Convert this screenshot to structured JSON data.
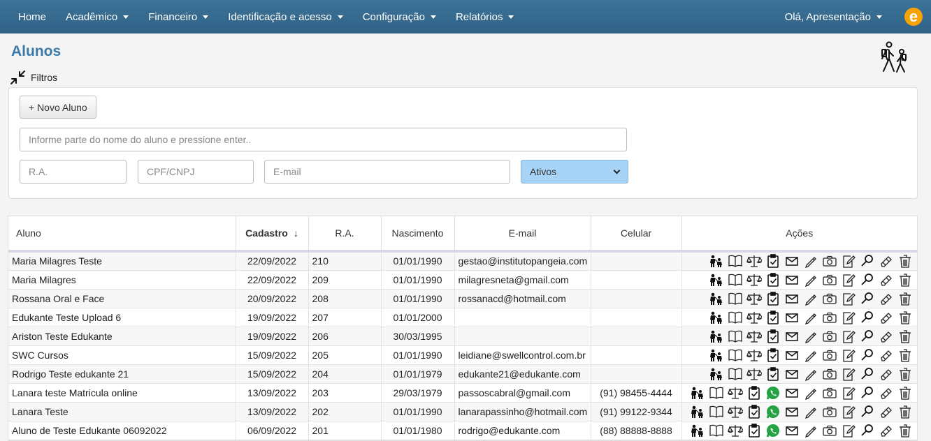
{
  "nav": {
    "items": [
      {
        "label": "Home",
        "dropdown": false
      },
      {
        "label": "Acadêmico",
        "dropdown": true
      },
      {
        "label": "Financeiro",
        "dropdown": true
      },
      {
        "label": "Identificação e acesso",
        "dropdown": true
      },
      {
        "label": "Configuração",
        "dropdown": true
      },
      {
        "label": "Relatórios",
        "dropdown": true
      }
    ],
    "user_greeting": "Olá, Apresentação",
    "logo_letter": "e"
  },
  "page": {
    "title": "Alunos",
    "filters_label": "Filtros"
  },
  "filters": {
    "new_button": "+ Novo Aluno",
    "name_placeholder": "Informe parte do nome do aluno e pressione enter..",
    "ra_placeholder": "R.A.",
    "doc_placeholder": "CPF/CNPJ",
    "email_placeholder": "E-mail",
    "status_selected": "Ativos"
  },
  "table": {
    "columns": [
      "Aluno",
      "Cadastro",
      "R.A.",
      "Nascimento",
      "E-mail",
      "Celular",
      "Ações"
    ],
    "sort_arrow": "↓",
    "rows": [
      {
        "name": "Maria Milagres Teste",
        "cadastro": "22/09/2022",
        "ra": "210",
        "nascimento": "01/01/1990",
        "email": "gestao@institutopangeia.com",
        "celular": "",
        "whatsapp": false
      },
      {
        "name": "Maria Milagres",
        "cadastro": "22/09/2022",
        "ra": "209",
        "nascimento": "01/01/1990",
        "email": "milagresneta@gmail.com",
        "celular": "",
        "whatsapp": false
      },
      {
        "name": "Rossana Oral e Face",
        "cadastro": "20/09/2022",
        "ra": "208",
        "nascimento": "01/01/1990",
        "email": "rossanacd@hotmail.com",
        "celular": "",
        "whatsapp": false
      },
      {
        "name": "Edukante Teste Upload 6",
        "cadastro": "19/09/2022",
        "ra": "207",
        "nascimento": "01/01/2000",
        "email": "",
        "celular": "",
        "whatsapp": false
      },
      {
        "name": "Ariston Teste Edukante",
        "cadastro": "19/09/2022",
        "ra": "206",
        "nascimento": "30/03/1995",
        "email": "",
        "celular": "",
        "whatsapp": false
      },
      {
        "name": "SWC Cursos",
        "cadastro": "15/09/2022",
        "ra": "205",
        "nascimento": "01/01/1990",
        "email": "leidiane@swellcontrol.com.br",
        "celular": "",
        "whatsapp": false
      },
      {
        "name": "Rodrigo Teste edukante 21",
        "cadastro": "15/09/2022",
        "ra": "204",
        "nascimento": "01/01/1979",
        "email": "edukante21@edukante.com",
        "celular": "",
        "whatsapp": false
      },
      {
        "name": "Lanara teste Matricula online",
        "cadastro": "13/09/2022",
        "ra": "203",
        "nascimento": "29/03/1979",
        "email": "passoscabral@gmail.com",
        "celular": "(91) 98455-4444",
        "whatsapp": true
      },
      {
        "name": "Lanara Teste",
        "cadastro": "13/09/2022",
        "ra": "202",
        "nascimento": "01/01/1990",
        "email": "lanarapassinho@hotmail.com",
        "celular": "(91) 99122-9344",
        "whatsapp": true
      },
      {
        "name": "Aluno de Teste Edukante 06092022",
        "cadastro": "06/09/2022",
        "ra": "201",
        "nascimento": "01/01/1980",
        "email": "rodrigo@edukante.com",
        "celular": "(88) 88888-8888",
        "whatsapp": true
      }
    ],
    "action_icons": [
      "guardian-icon",
      "book-icon",
      "scales-icon",
      "clipboard-check-icon",
      "whatsapp-icon",
      "envelope-icon",
      "pencil-icon",
      "camera-icon",
      "edit-note-icon",
      "magnifier-icon",
      "eraser-icon",
      "trash-icon"
    ]
  },
  "colors": {
    "navbar": "#2f6286",
    "title": "#3b79a8",
    "select_bg": "#a7d3f7",
    "whatsapp": "#25a244",
    "logo": "#f5a300"
  }
}
